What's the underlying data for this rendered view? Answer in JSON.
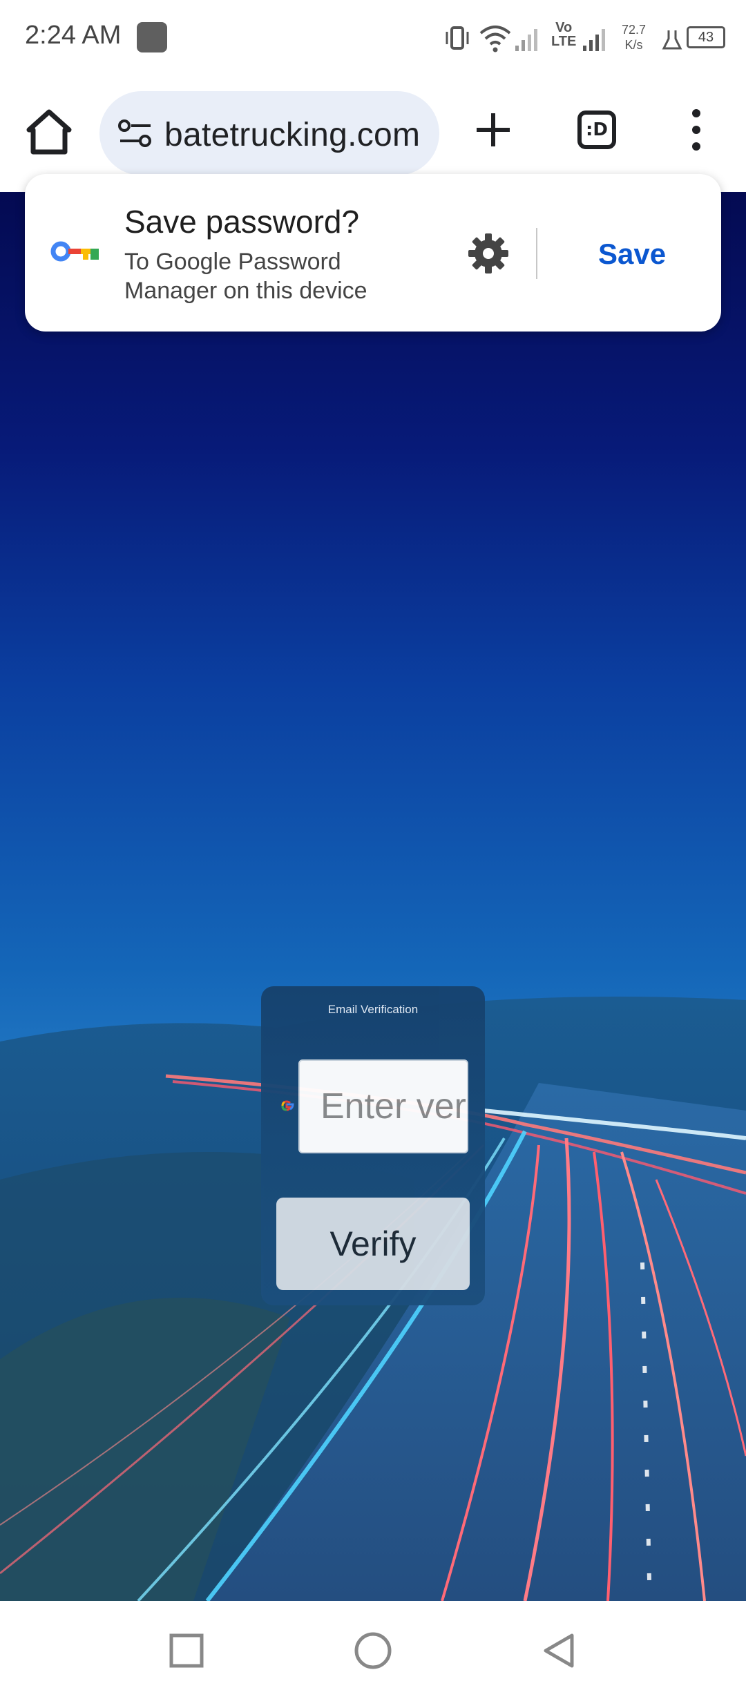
{
  "status_bar": {
    "time": "2:24 AM",
    "network_speed_value": "72.7",
    "network_speed_unit": "K/s",
    "volte_label_top": "Vo",
    "volte_label_bottom": "LTE",
    "battery_level": "43"
  },
  "browser": {
    "url": "batetrucking.com",
    "tab_switcher_label": ":D"
  },
  "password_prompt": {
    "title": "Save password?",
    "subtitle": "To Google Password Manager on this device",
    "save_label": "Save"
  },
  "verification": {
    "title": "Email Verification",
    "input_placeholder": "Enter verification code",
    "verify_label": "Verify"
  },
  "colors": {
    "accent_blue": "#0b57d0",
    "omnibox_bg": "#e9eef8",
    "card_bg": "#184a78",
    "verify_button_bg": "#d4dce4"
  }
}
